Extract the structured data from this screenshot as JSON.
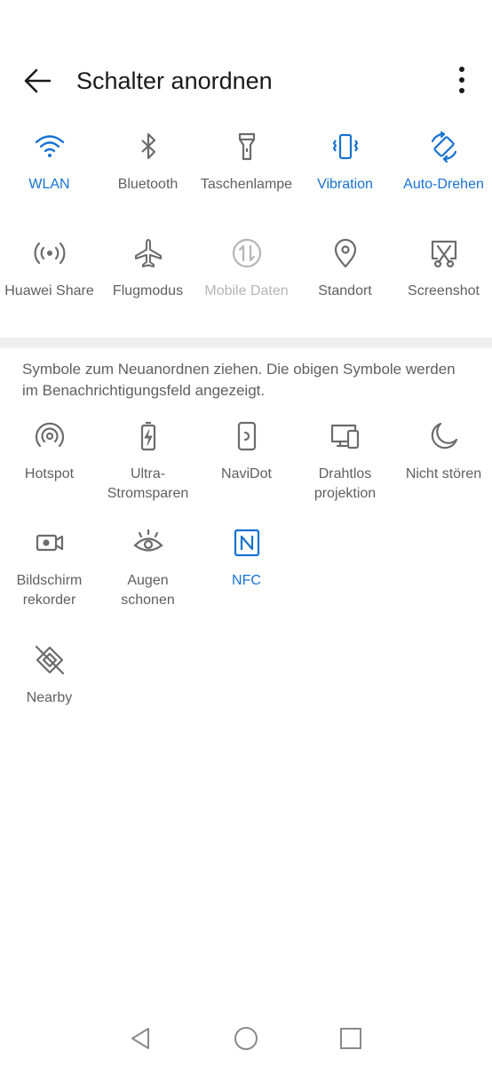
{
  "header": {
    "title": "Schalter anordnen"
  },
  "active_tiles": [
    {
      "label": "WLAN",
      "state": "on",
      "icon": "wifi-icon"
    },
    {
      "label": "Bluetooth",
      "state": "off",
      "icon": "bluetooth-icon"
    },
    {
      "label": "Taschenlampe",
      "state": "off",
      "icon": "flashlight-icon"
    },
    {
      "label": "Vibration",
      "state": "on",
      "icon": "vibration-icon"
    },
    {
      "label": "Auto-Drehen",
      "state": "on",
      "icon": "auto-rotate-icon"
    },
    {
      "label": "Huawei Share",
      "state": "off",
      "icon": "huawei-share-icon"
    },
    {
      "label": "Flugmodus",
      "state": "off",
      "icon": "airplane-icon"
    },
    {
      "label": "Mobile Daten",
      "state": "disabled",
      "icon": "mobile-data-icon"
    },
    {
      "label": "Standort",
      "state": "off",
      "icon": "location-icon"
    },
    {
      "label": "Screenshot",
      "state": "off",
      "icon": "screenshot-icon"
    }
  ],
  "hint": "Symbole zum Neuanordnen ziehen. Die obigen Symbole werden im Benachrichtigungsfeld angezeigt.",
  "available_tiles": [
    {
      "label": "Hotspot",
      "state": "off",
      "icon": "hotspot-icon"
    },
    {
      "label": "Ultra-\nStromsparen",
      "state": "off",
      "icon": "battery-saver-icon"
    },
    {
      "label": "NaviDot",
      "state": "off",
      "icon": "navidot-icon"
    },
    {
      "label": "Drahtlos\nprojektion",
      "state": "off",
      "icon": "wireless-projection-icon"
    },
    {
      "label": "Nicht stören",
      "state": "off",
      "icon": "moon-icon"
    },
    {
      "label": "Bildschirm\nrekorder",
      "state": "off",
      "icon": "screen-recorder-icon"
    },
    {
      "label": "Augen schonen",
      "state": "off",
      "icon": "eye-icon"
    },
    {
      "label": "NFC",
      "state": "on",
      "icon": "nfc-icon"
    },
    {
      "label": "Nearby",
      "state": "off",
      "icon": "nearby-icon"
    }
  ],
  "colors": {
    "accent": "#1672d2",
    "icon": "#6b6b6b",
    "disabled": "#b5b5b5",
    "title": "#1a1a1a"
  }
}
